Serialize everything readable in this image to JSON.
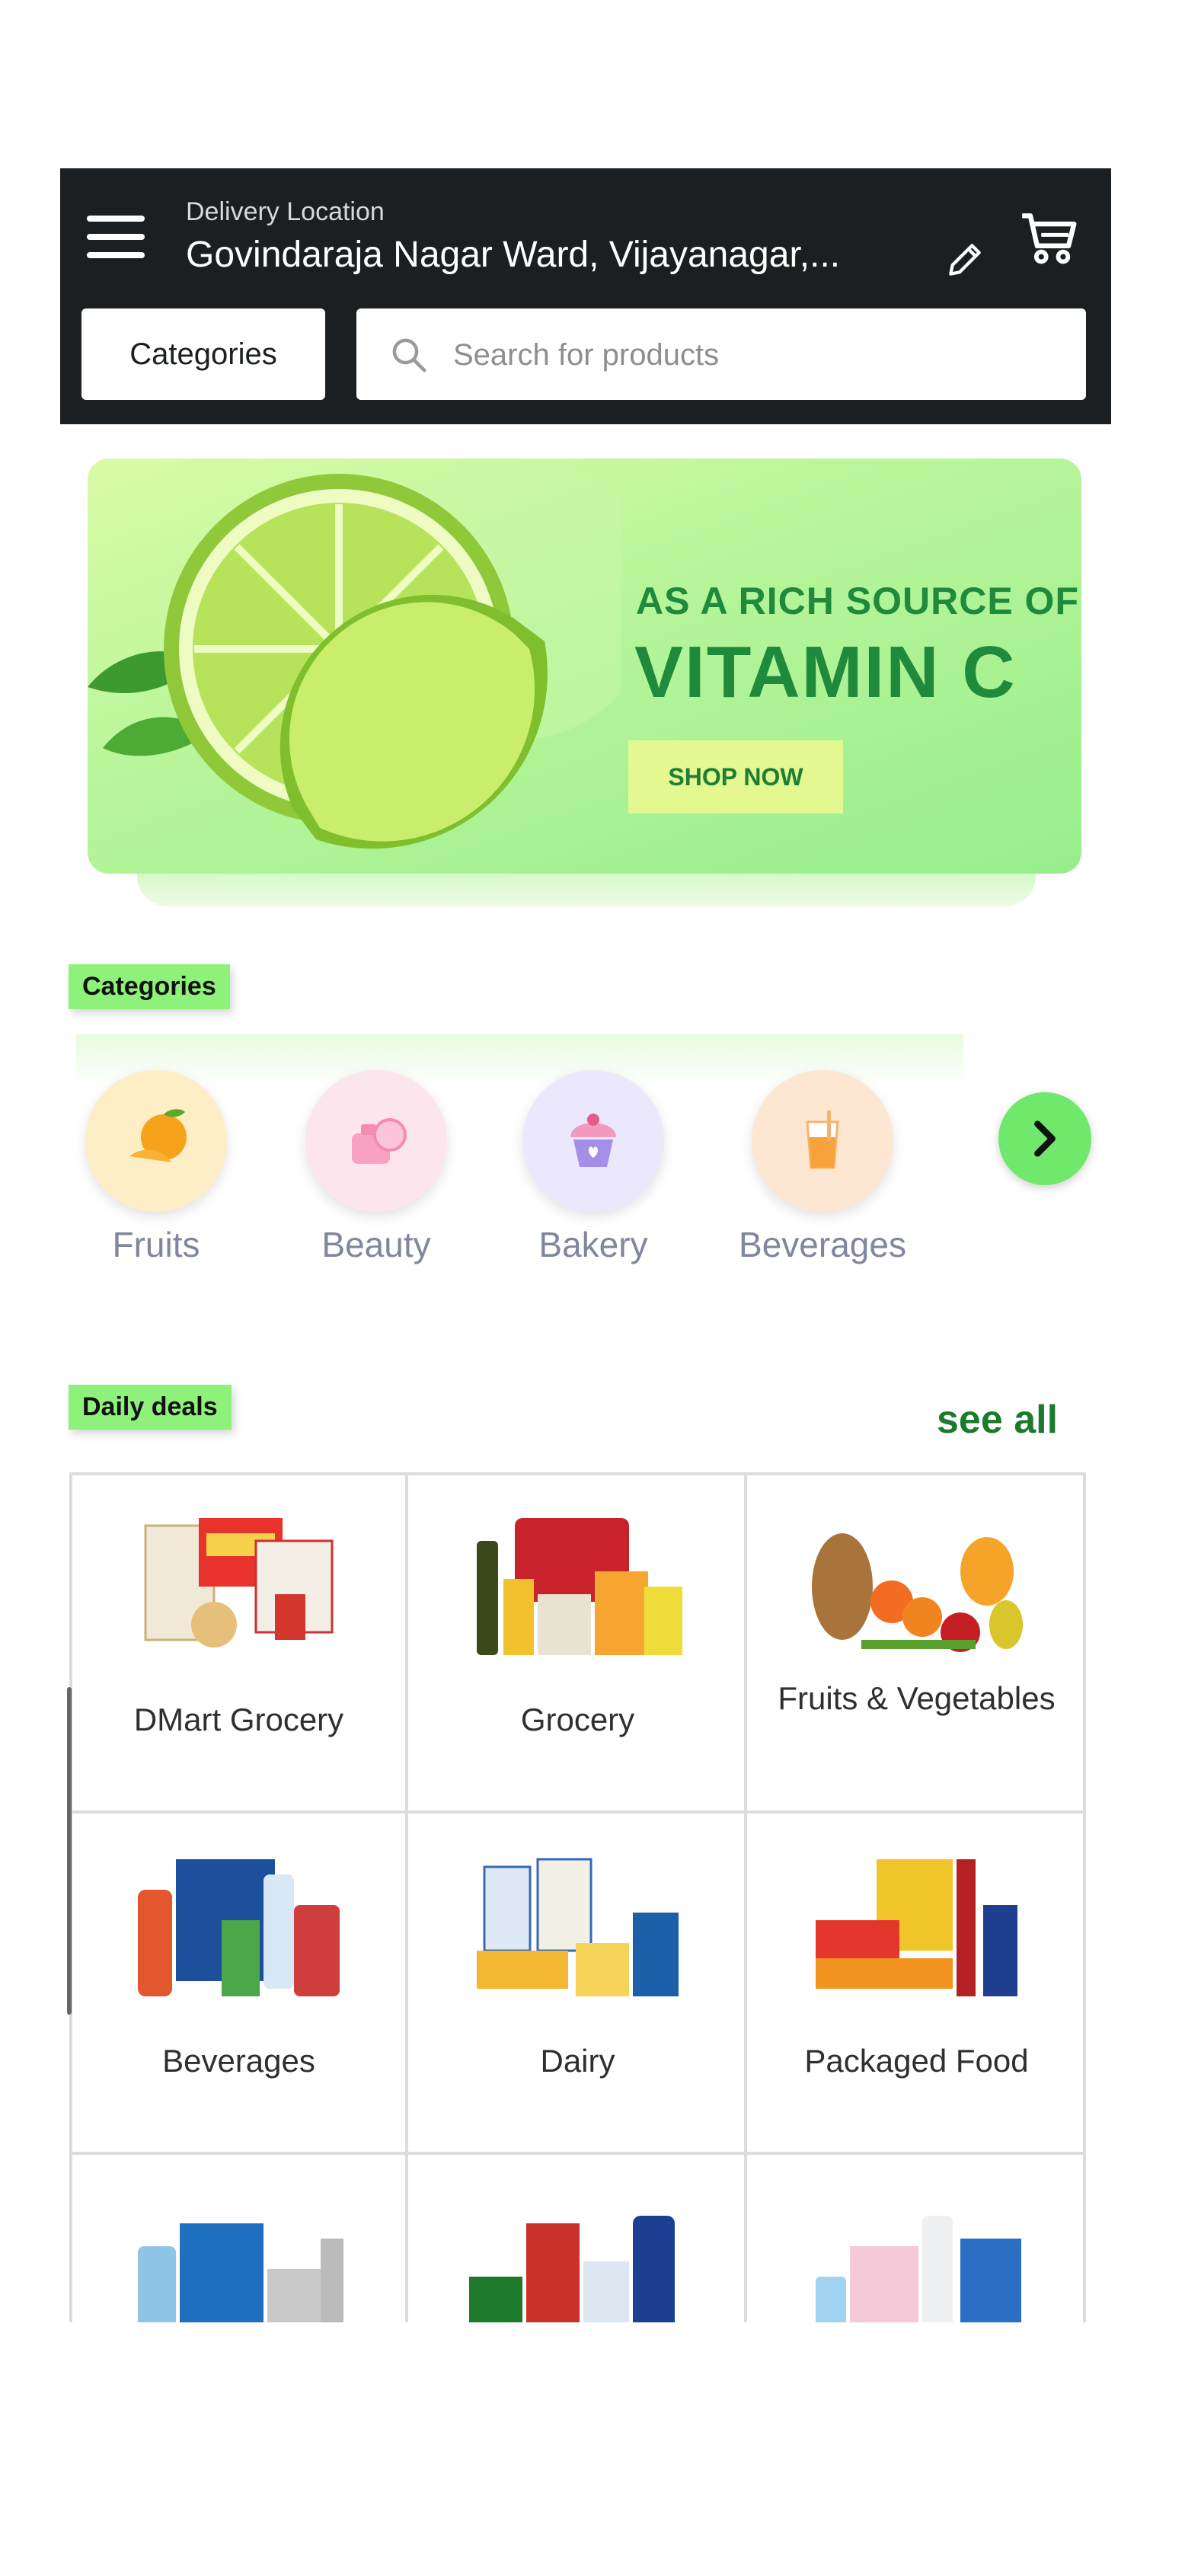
{
  "header": {
    "location_label": "Delivery Location",
    "location_value": "Govindaraja Nagar Ward, Vijayanagar,...",
    "categories_button": "Categories",
    "search_placeholder": "Search for products"
  },
  "banner": {
    "subtitle": "AS A RICH SOURCE OF",
    "title": "VITAMIN C",
    "cta": "SHOP NOW"
  },
  "categories_section": {
    "label": "Categories",
    "items": [
      {
        "label": "Fruits",
        "icon": "orange-fruit-icon",
        "color": "#fde9b8"
      },
      {
        "label": "Beauty",
        "icon": "cosmetics-icon",
        "color": "#fde2ea"
      },
      {
        "label": "Bakery",
        "icon": "cupcake-icon",
        "color": "#e8e4fb"
      },
      {
        "label": "Beverages",
        "icon": "juice-glass-icon",
        "color": "#fde3cc"
      }
    ]
  },
  "daily_deals": {
    "label": "Daily deals",
    "see_all": "see all",
    "items": [
      {
        "label": "DMart Grocery"
      },
      {
        "label": "Grocery"
      },
      {
        "label": "Fruits & Vegetables"
      },
      {
        "label": "Beverages"
      },
      {
        "label": "Dairy"
      },
      {
        "label": "Packaged Food"
      },
      {
        "label": ""
      },
      {
        "label": ""
      },
      {
        "label": ""
      }
    ]
  },
  "colors": {
    "header_bg": "#1c1f22",
    "accent_green": "#8ef27a",
    "banner_text": "#1f8a3b",
    "see_all": "#1b7a2c"
  }
}
